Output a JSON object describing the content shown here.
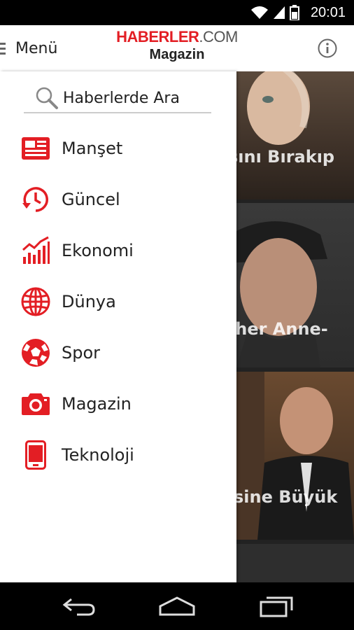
{
  "status": {
    "time": "20:01"
  },
  "header": {
    "menu_label": "Menü",
    "logo_main": "HABERLER",
    "logo_domain": ".COM",
    "subtitle": "Magazin"
  },
  "search": {
    "placeholder": "Haberlerde Ara"
  },
  "nav": {
    "items": [
      {
        "label": "Manşet",
        "icon": "newspaper-icon"
      },
      {
        "label": "Güncel",
        "icon": "clock-refresh-icon"
      },
      {
        "label": "Ekonomi",
        "icon": "chart-icon"
      },
      {
        "label": "Dünya",
        "icon": "globe-icon"
      },
      {
        "label": "Spor",
        "icon": "soccer-ball-icon"
      },
      {
        "label": "Magazin",
        "icon": "camera-icon"
      },
      {
        "label": "Teknoloji",
        "icon": "phone-icon"
      }
    ]
  },
  "feed": {
    "items": [
      {
        "title": "sını Bırakıp"
      },
      {
        "title": "cher Anne-"
      },
      {
        "title": "sine Büyük"
      }
    ]
  },
  "colors": {
    "accent": "#e31e24",
    "text": "#222222",
    "background": "#ffffff"
  }
}
